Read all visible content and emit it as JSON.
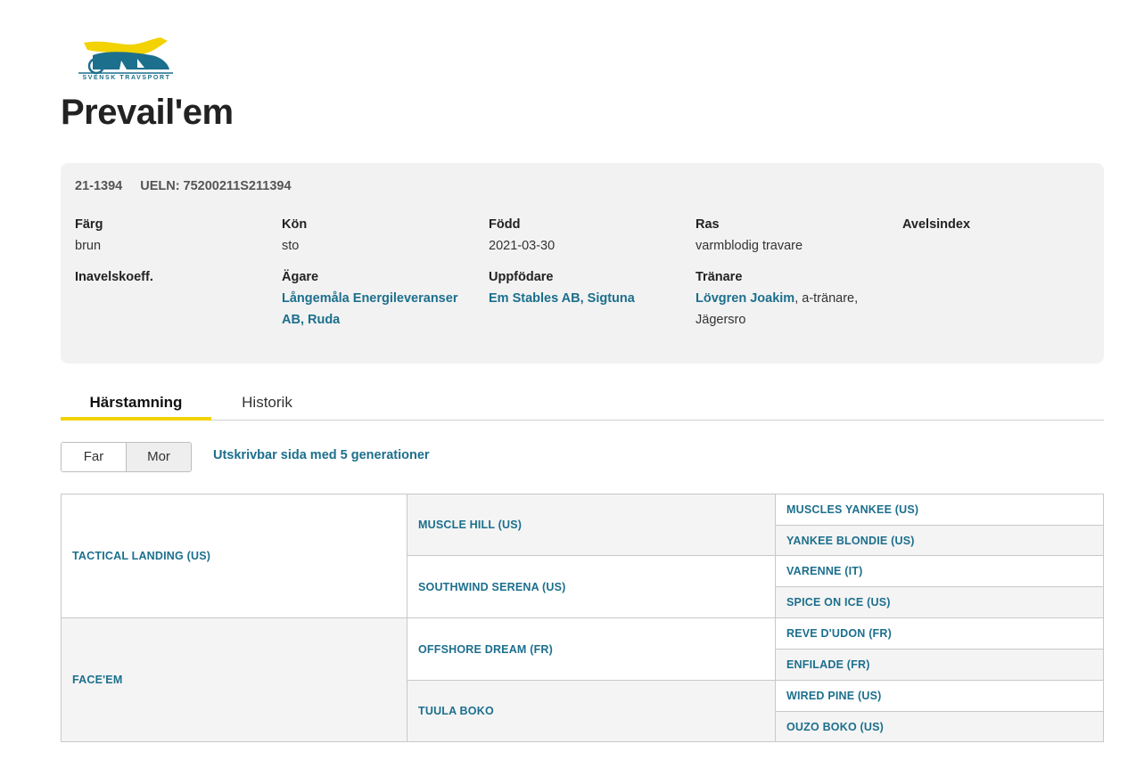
{
  "logo": {
    "text": "SVENSK TRAVSPORT",
    "colors": {
      "horse": "#f2d200",
      "sulky": "#1c6f8d"
    }
  },
  "horse": {
    "name": "Prevail'em"
  },
  "info": {
    "reg_no": "21-1394",
    "ueln": "UELN: 75200211S211394",
    "fields": {
      "farg": {
        "label": "Färg",
        "value": "brun"
      },
      "kon": {
        "label": "Kön",
        "value": "sto"
      },
      "fodd": {
        "label": "Född",
        "value": "2021-03-30"
      },
      "ras": {
        "label": "Ras",
        "value": "varmblodig travare"
      },
      "avelsindex": {
        "label": "Avelsindex",
        "value": ""
      },
      "inavelskoeff": {
        "label": "Inavelskoeff.",
        "value": ""
      },
      "agare": {
        "label": "Ägare",
        "value": "Långemåla Energileveranser AB, Ruda"
      },
      "uppfodare": {
        "label": "Uppfödare",
        "value": "Em Stables AB, Sigtuna"
      },
      "tranare": {
        "label": "Tränare",
        "link": "Lövgren Joakim",
        "suffix": ", a-tränare, Jägersro"
      }
    }
  },
  "tabs": [
    {
      "label": "Härstamning",
      "active": true
    },
    {
      "label": "Historik",
      "active": false
    }
  ],
  "toggle": {
    "far": "Far",
    "mor": "Mor",
    "selected": "Far"
  },
  "print_link": "Utskrivbar sida med 5 generationer",
  "pedigree": {
    "gen1": [
      "TACTICAL LANDING (US)",
      "FACE'EM"
    ],
    "gen2": [
      "MUSCLE HILL (US)",
      "SOUTHWIND SERENA (US)",
      "OFFSHORE DREAM (FR)",
      "TUULA BOKO"
    ],
    "gen3": [
      "MUSCLES YANKEE (US)",
      "YANKEE BLONDIE (US)",
      "VARENNE (IT)",
      "SPICE ON ICE (US)",
      "REVE D'UDON (FR)",
      "ENFILADE (FR)",
      "WIRED PINE (US)",
      "OUZO BOKO (US)"
    ]
  },
  "colors": {
    "link": "#1c6f8d",
    "accent": "#f2d200",
    "card_bg": "#f2f2f2"
  }
}
